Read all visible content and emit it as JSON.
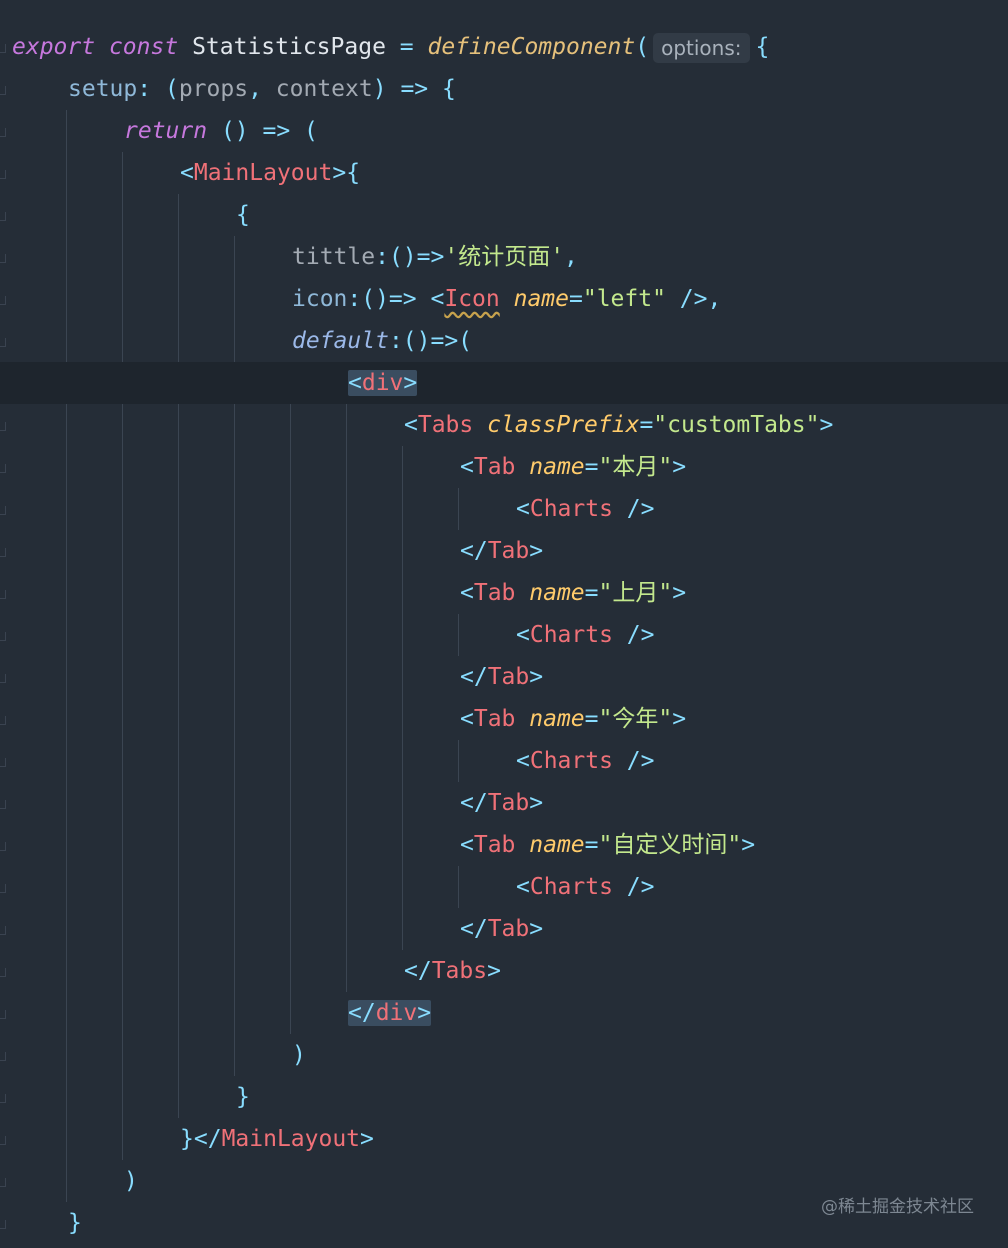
{
  "code": {
    "line1": {
      "export": "export",
      "const": "const",
      "name": "StatisticsPage",
      "eq": "=",
      "fn": "defineComponent",
      "paren": "(",
      "hint": "options:",
      "brace": "{"
    },
    "line2": {
      "key": "setup",
      "colon": ":",
      "params_open": "(",
      "p1": "props",
      "comma": ",",
      "p2": "context",
      "params_close": ")",
      "arrow": "=>",
      "brace": "{"
    },
    "line3": {
      "ret": "return",
      "rest": "() => ("
    },
    "line4": {
      "lt": "<",
      "tag": "MainLayout",
      "gt": ">",
      "brace": "{"
    },
    "line5": {
      "brace": "{"
    },
    "line6": {
      "key": "tittle",
      "rest": ":()=>",
      "str": "'统计页面'",
      "comma": ","
    },
    "line7": {
      "key": "icon",
      "rest": ":()=> ",
      "lt": "<",
      "tag": "Icon",
      "attr": "name",
      "eq": "=",
      "str": "\"left\"",
      "close": " />,"
    },
    "line8": {
      "key": "default",
      "rest": ":()=>("
    },
    "line9": {
      "lt": "<",
      "tag": "div",
      "gt": ">"
    },
    "line10": {
      "lt": "<",
      "tag": "Tabs",
      "attr": "classPrefix",
      "eq": "=",
      "str": "\"customTabs\"",
      "gt": ">"
    },
    "tab1": {
      "name": "\"本月\""
    },
    "tab2": {
      "name": "\"上月\""
    },
    "tab3": {
      "name": "\"今年\""
    },
    "tab4": {
      "name": "\"自定义时间\""
    },
    "tab_common": {
      "lt": "<",
      "tag": "Tab",
      "attr": "name",
      "eq": "=",
      "gt": ">",
      "charts_lt": "<",
      "charts": "Charts",
      "charts_close": " />",
      "close_lt": "</",
      "close_gt": ">"
    },
    "line27": {
      "lt": "</",
      "tag": "Tabs",
      "gt": ">"
    },
    "line28": {
      "lt": "</",
      "tag": "div",
      "gt": ">"
    },
    "line29": {
      "text": ")"
    },
    "line30": {
      "text": "}"
    },
    "line31": {
      "brace": "}",
      "lt": "</",
      "tag": "MainLayout",
      "gt": ">"
    },
    "line32": {
      "text": ")"
    },
    "line33": {
      "text": "}"
    }
  },
  "watermark": "@稀土掘金技术社区",
  "colors": {
    "background": "#252d37",
    "tag": "#f07178",
    "string": "#c3e88d",
    "keyword": "#c678dd",
    "attribute": "#ffcb6b"
  }
}
